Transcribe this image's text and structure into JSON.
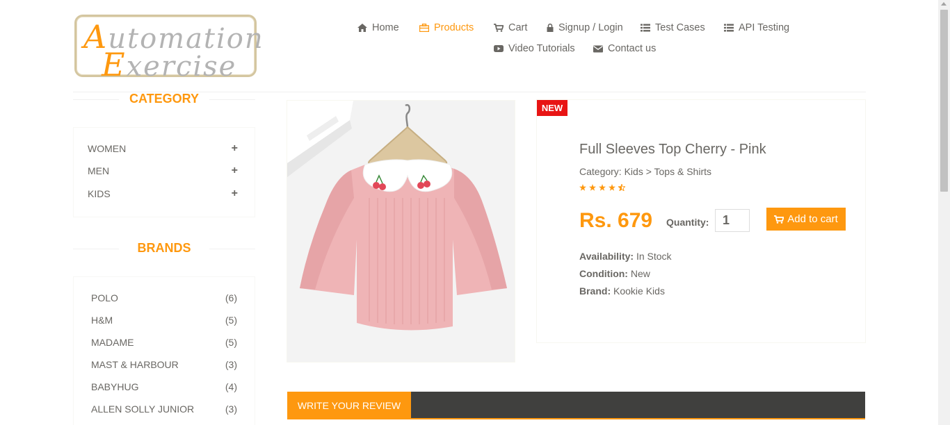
{
  "logo": {
    "line1_cap": "A",
    "line1_rest": "utomation",
    "line2_cap": "E",
    "line2_rest": "xercise"
  },
  "nav": {
    "items": [
      {
        "label": "Home",
        "icon": "home-icon"
      },
      {
        "label": "Products",
        "icon": "products-icon",
        "active": true
      },
      {
        "label": "Cart",
        "icon": "cart-icon"
      },
      {
        "label": "Signup / Login",
        "icon": "lock-icon"
      },
      {
        "label": "Test Cases",
        "icon": "list-icon"
      },
      {
        "label": "API Testing",
        "icon": "list-icon"
      },
      {
        "label": "Video Tutorials",
        "icon": "youtube-play-icon"
      },
      {
        "label": "Contact us",
        "icon": "envelope-icon"
      }
    ]
  },
  "sidebar": {
    "category_title": "CATEGORY",
    "categories": [
      {
        "label": "WOMEN"
      },
      {
        "label": "MEN"
      },
      {
        "label": "KIDS"
      }
    ],
    "brands_title": "BRANDS",
    "brands": [
      {
        "label": "POLO",
        "count": "(6)"
      },
      {
        "label": "H&M",
        "count": "(5)"
      },
      {
        "label": "MADAME",
        "count": "(5)"
      },
      {
        "label": "MAST & HARBOUR",
        "count": "(3)"
      },
      {
        "label": "BABYHUG",
        "count": "(4)"
      },
      {
        "label": "ALLEN SOLLY JUNIOR",
        "count": "(3)"
      }
    ]
  },
  "product": {
    "badge": "NEW",
    "name": "Full Sleeves Top Cherry - Pink",
    "category": "Category: Kids > Tops & Shirts",
    "rating": 4.5,
    "price": "Rs. 679",
    "quantity_label": "Quantity:",
    "quantity_value": "1",
    "add_to_cart": "Add to cart",
    "availability_label": "Availability:",
    "availability": "In Stock",
    "condition_label": "Condition:",
    "condition": "New",
    "brand_label": "Brand:",
    "brand": "Kookie Kids"
  },
  "review": {
    "tab_label": "WRITE YOUR REVIEW"
  },
  "colors": {
    "accent": "#fe980f",
    "text": "#696763",
    "badge": "#e81414",
    "dark_bar": "#40403e"
  }
}
